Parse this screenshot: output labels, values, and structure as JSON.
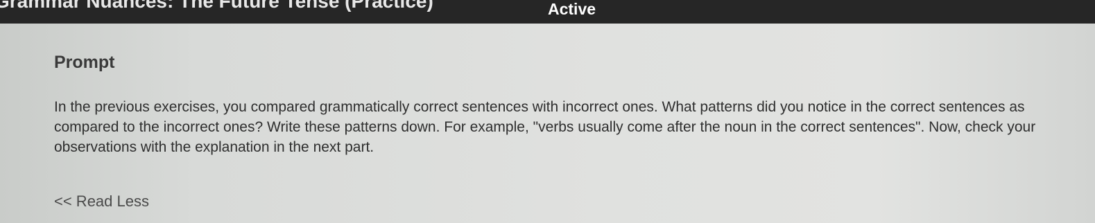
{
  "header": {
    "lesson_title": "Grammar Nuances: The Future Tense (Practice)",
    "status": "Active"
  },
  "prompt": {
    "heading": "Prompt",
    "body": "In the previous exercises, you compared grammatically correct sentences with incorrect ones. What patterns did you notice in the correct sentences as compared to the incorrect ones? Write these patterns down. For example, \"verbs usually come after the noun in the correct sentences\". Now, check your observations with the explanation in the next part.",
    "toggle_label": "<< Read Less"
  }
}
